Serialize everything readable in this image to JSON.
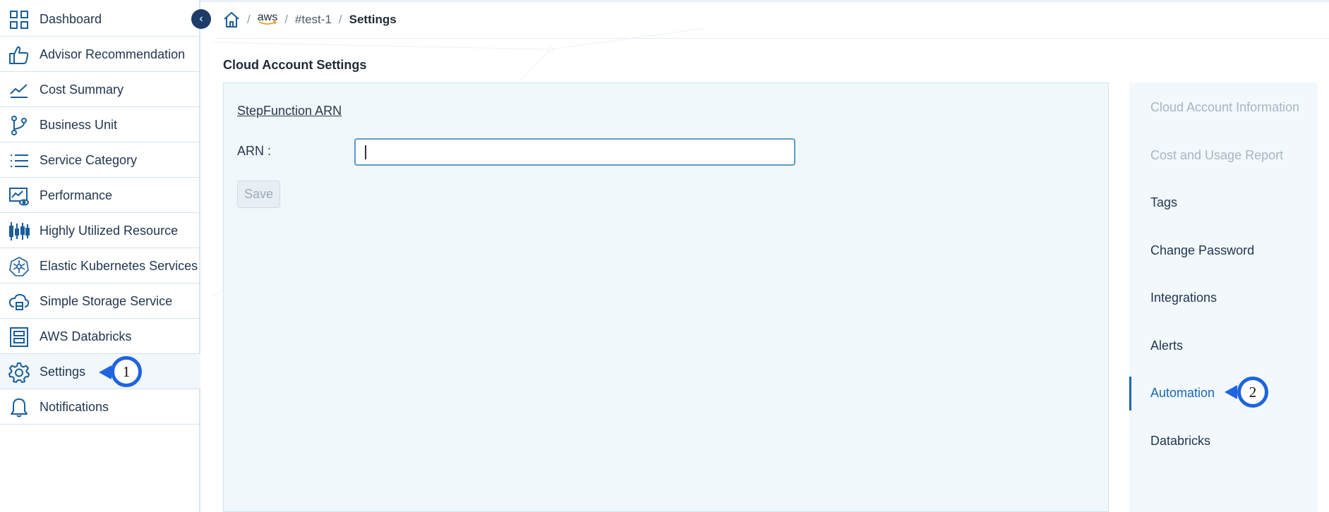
{
  "sidebar": {
    "collapse_icon": "chevron-left-icon",
    "items": [
      {
        "label": "Dashboard",
        "icon": "grid-icon"
      },
      {
        "label": "Advisor Recommendation",
        "icon": "thumbs-up-icon"
      },
      {
        "label": "Cost Summary",
        "icon": "line-chart-icon"
      },
      {
        "label": "Business Unit",
        "icon": "branch-icon"
      },
      {
        "label": "Service Category",
        "icon": "list-icon"
      },
      {
        "label": "Performance",
        "icon": "monitor-eye-icon"
      },
      {
        "label": "Highly Utilized Resource",
        "icon": "candlestick-icon"
      },
      {
        "label": "Elastic Kubernetes Services",
        "icon": "kubernetes-icon"
      },
      {
        "label": "Simple Storage Service",
        "icon": "cloud-storage-icon"
      },
      {
        "label": "AWS Databricks",
        "icon": "databricks-icon"
      },
      {
        "label": "Settings",
        "icon": "gear-icon"
      },
      {
        "label": "Notifications",
        "icon": "bell-icon"
      }
    ]
  },
  "breadcrumb": {
    "home_icon": "home-icon",
    "provider": "aws",
    "account": "#test-1",
    "current": "Settings",
    "separator": "/"
  },
  "main": {
    "title": "Cloud Account Settings",
    "section_title": "StepFunction ARN",
    "arn_label": "ARN :",
    "arn_value": "",
    "save_label": "Save"
  },
  "right_nav": {
    "items": [
      {
        "label": "Cloud Account Information",
        "state": "disabled"
      },
      {
        "label": "Cost and Usage Report",
        "state": "disabled"
      },
      {
        "label": "Tags",
        "state": "normal"
      },
      {
        "label": "Change Password",
        "state": "normal"
      },
      {
        "label": "Integrations",
        "state": "normal"
      },
      {
        "label": "Alerts",
        "state": "normal"
      },
      {
        "label": "Automation",
        "state": "active"
      },
      {
        "label": "Databricks",
        "state": "normal"
      }
    ]
  },
  "markers": [
    {
      "label": "1"
    },
    {
      "label": "2"
    }
  ],
  "colors": {
    "accent": "#1967b8",
    "sidebar_icon": "#1a5d9a",
    "marker": "#1e63e0",
    "panel_bg": "#f1f8fc"
  }
}
